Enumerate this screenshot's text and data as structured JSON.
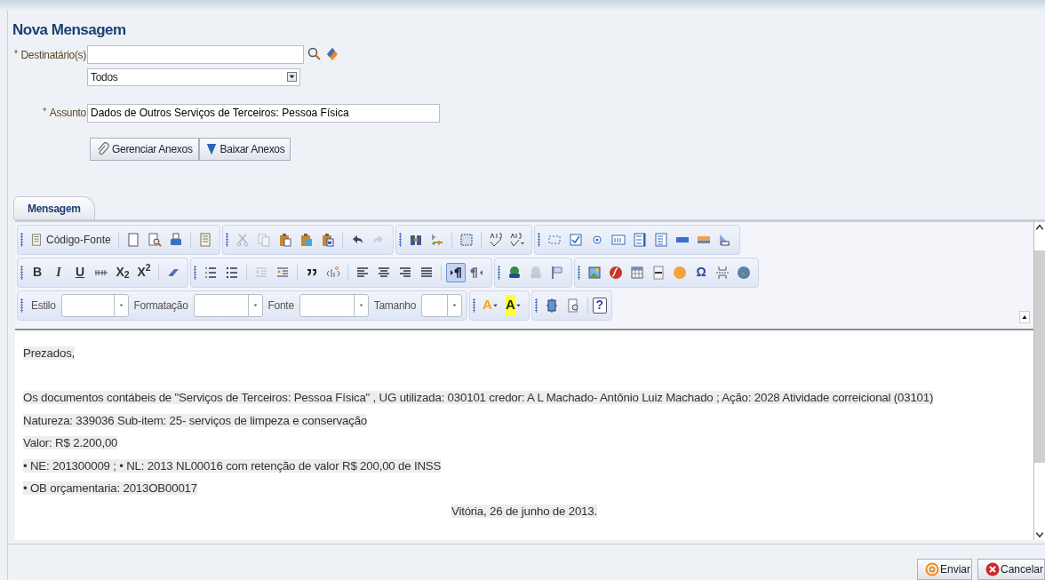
{
  "title": "Nova Mensagem",
  "recipients": {
    "label": "Destinatário(s)",
    "required_mark": "*",
    "value_select": "Todos"
  },
  "subject": {
    "label": "Assunto",
    "required_mark": "*",
    "value": "Dados de Outros Serviços de Terceiros: Pessoa Física"
  },
  "attachment_buttons": [
    {
      "label": "Gerenciar Anexos"
    },
    {
      "label": "Baixar Anexos"
    }
  ],
  "tabs": [
    {
      "label": "Mensagem",
      "selected": true
    }
  ],
  "toolbar": {
    "rows": [
      [
        [
          {
            "kind": "source",
            "label": "Código-Fonte"
          },
          {
            "kind": "sep"
          },
          {
            "kind": "icon",
            "disabled": false
          },
          {
            "kind": "icon",
            "disabled": false
          },
          {
            "kind": "icon",
            "disabled": false
          },
          {
            "kind": "sep"
          },
          {
            "kind": "icon",
            "disabled": false
          }
        ],
        [
          {
            "kind": "icon",
            "disabled": true
          },
          {
            "kind": "icon",
            "disabled": true
          },
          {
            "kind": "icon",
            "disabled": false
          },
          {
            "kind": "icon",
            "disabled": false
          },
          {
            "kind": "icon",
            "disabled": false
          },
          {
            "kind": "sep"
          },
          {
            "kind": "icon",
            "disabled": false
          },
          {
            "kind": "icon",
            "disabled": true
          }
        ],
        [
          {
            "kind": "icon",
            "disabled": false
          },
          {
            "kind": "icon",
            "disabled": false
          },
          {
            "kind": "sep"
          },
          {
            "kind": "icon",
            "disabled": false
          },
          {
            "kind": "sep"
          },
          {
            "kind": "icon",
            "disabled": false
          },
          {
            "kind": "icon",
            "disabled": false
          }
        ],
        [
          {
            "kind": "icon",
            "disabled": false
          },
          {
            "kind": "icon",
            "disabled": false
          },
          {
            "kind": "icon",
            "disabled": false
          },
          {
            "kind": "icon",
            "disabled": false
          },
          {
            "kind": "icon",
            "disabled": false
          },
          {
            "kind": "icon",
            "disabled": false
          },
          {
            "kind": "icon",
            "disabled": false
          },
          {
            "kind": "icon",
            "disabled": false
          },
          {
            "kind": "icon",
            "disabled": false
          }
        ]
      ],
      [
        [
          {
            "kind": "bold",
            "label": "B"
          },
          {
            "kind": "italic",
            "label": "I"
          },
          {
            "kind": "underline",
            "label": "U"
          },
          {
            "kind": "icon",
            "disabled": false
          },
          {
            "kind": "bold",
            "label": "X$_{2}$"
          },
          {
            "kind": "bold",
            "label": "X$^{2}$"
          },
          {
            "kind": "sep"
          },
          {
            "kind": "icon",
            "disabled": false
          }
        ],
        [
          {
            "kind": "icon",
            "disabled": false
          },
          {
            "kind": "icon",
            "disabled": false
          },
          {
            "kind": "sep"
          },
          {
            "kind": "icon",
            "disabled": true
          },
          {
            "kind": "icon",
            "disabled": false
          },
          {
            "kind": "sep"
          },
          {
            "kind": "icon",
            "disabled": false
          },
          {
            "kind": "icon",
            "disabled": false
          },
          {
            "kind": "sep"
          },
          {
            "kind": "icon",
            "disabled": false
          },
          {
            "kind": "icon",
            "disabled": false
          },
          {
            "kind": "icon",
            "disabled": false
          },
          {
            "kind": "icon",
            "disabled": false
          },
          {
            "kind": "sep"
          },
          {
            "kind": "toggle",
            "selected": true
          },
          {
            "kind": "toggle",
            "selected": false
          }
        ],
        [
          {
            "kind": "icon",
            "disabled": false
          },
          {
            "kind": "icon",
            "disabled": true
          },
          {
            "kind": "icon",
            "disabled": false
          }
        ],
        [
          {
            "kind": "icon",
            "disabled": false
          },
          {
            "kind": "icon",
            "disabled": false
          },
          {
            "kind": "icon",
            "disabled": false
          },
          {
            "kind": "icon",
            "disabled": false
          },
          {
            "kind": "icon",
            "disabled": false
          },
          {
            "kind": "symbol",
            "label": "Ω"
          },
          {
            "kind": "icon",
            "disabled": false
          },
          {
            "kind": "icon",
            "disabled": false
          }
        ]
      ],
      [
        [
          {
            "kind": "combo",
            "label": "Estilo"
          },
          {
            "kind": "combo",
            "label": "Formatação"
          },
          {
            "kind": "combo",
            "label": "Fonte"
          },
          {
            "kind": "combo",
            "label": "Tamanho"
          }
        ],
        [
          {
            "kind": "color",
            "label": "A",
            "color": "#f4a21c"
          },
          {
            "kind": "color",
            "label": "A",
            "color": "#ffff33"
          }
        ],
        [
          {
            "kind": "icon",
            "disabled": false
          },
          {
            "kind": "icon",
            "disabled": false
          },
          {
            "kind": "sep"
          },
          {
            "kind": "help",
            "label": "?"
          }
        ]
      ]
    ]
  },
  "message": [
    {
      "text": "Prezados,",
      "kind": "plain"
    },
    {
      "kind": "blank"
    },
    {
      "text": "Os documentos contábeis de \"Serviços de Terceiros: Pessoa Física\" , UG utilizada: 030101 credor: A L Machado- Antônio Luiz Machado ; Ação: 2028 Atividade correicional (03101)",
      "kind": "plain"
    },
    {
      "text": "Natureza: 339036 Sub-item: 25- serviços de limpeza e conservação",
      "kind": "plain"
    },
    {
      "text": "Valor: R$ 2.200,00",
      "kind": "plain"
    },
    {
      "text": "• NE: 201300009 ; • NL: 2013 NL00016 com retenção de valor R$ 200,00 de INSS",
      "kind": "plain"
    },
    {
      "text": "• OB orçamentaria: 2013OB00017",
      "kind": "plain"
    },
    {
      "text": "Vitória, 26 de junho de 2013.",
      "kind": "centered"
    }
  ],
  "actions": [
    {
      "label": "Enviar"
    },
    {
      "label": "Cancelar"
    }
  ]
}
